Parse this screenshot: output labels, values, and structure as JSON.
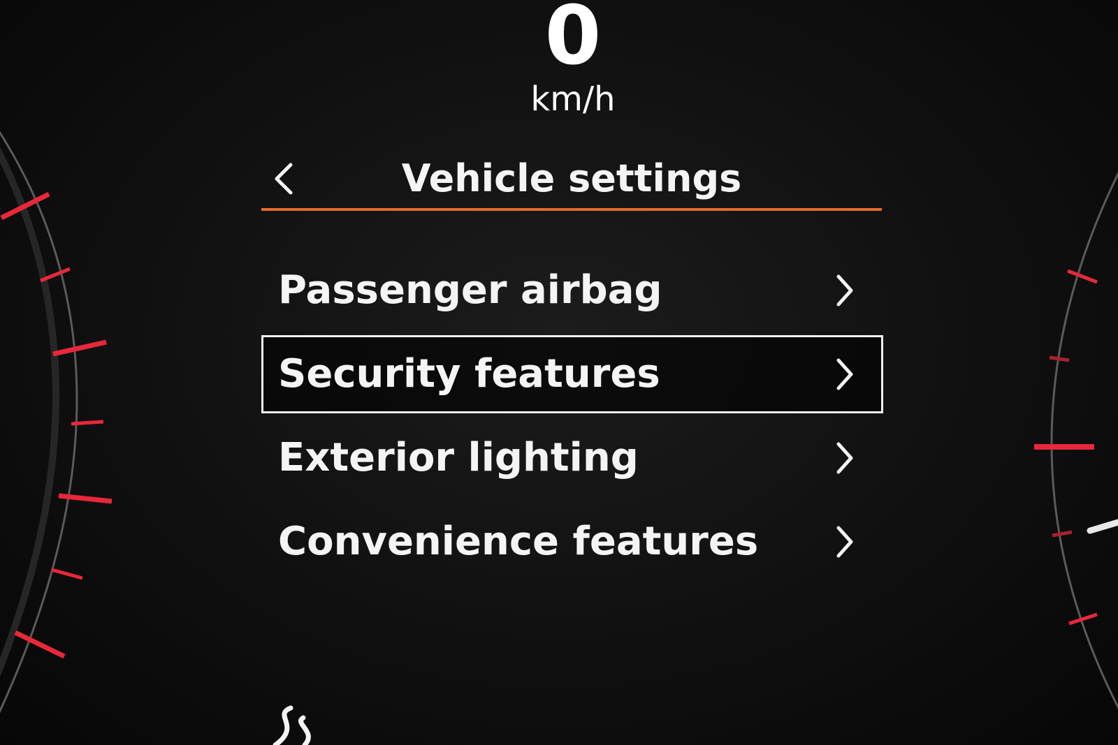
{
  "speed": {
    "value": "0",
    "unit": "km/h"
  },
  "header": {
    "title": "Vehicle settings",
    "back_icon": "chevron-left-icon"
  },
  "menu": {
    "selected_index": 1,
    "items": [
      {
        "label": "Passenger airbag",
        "icon": "chevron-right-icon"
      },
      {
        "label": "Security features",
        "icon": "chevron-right-icon"
      },
      {
        "label": "Exterior lighting",
        "icon": "chevron-right-icon"
      },
      {
        "label": "Convenience features",
        "icon": "chevron-right-icon"
      }
    ]
  },
  "footer": {
    "icon": "lane-assist-icon"
  },
  "colors": {
    "background": "#121212",
    "text": "#f4f4f4",
    "accent_rule": "#e46a2c",
    "gauge_tick": "#e8283a",
    "selection_border": "#f0f0f0"
  }
}
